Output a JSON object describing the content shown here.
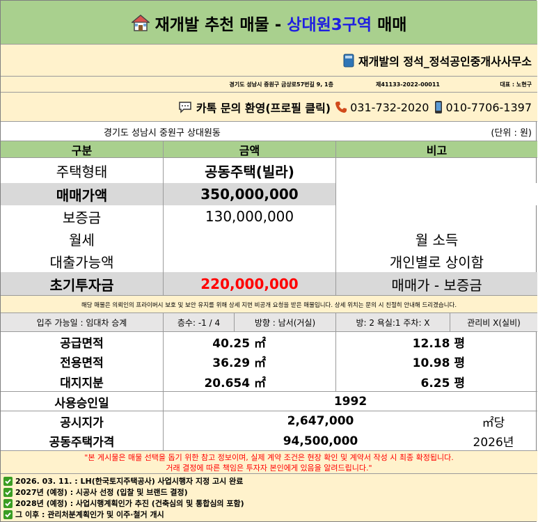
{
  "title": {
    "prefix": "재개발 추천 매물 - ",
    "highlight": "상대원3구역",
    "suffix": " 매매",
    "highlight_color": "#1f1fe0"
  },
  "office": {
    "name": "재개발의 정석_정석공인중개사사무소",
    "address": "경기도 성남시 중원구 금상로57번길 9, 1층",
    "reg_no": "제41133-2022-00011",
    "ceo": "대표 : 노현구",
    "contact_kakao": "카톡 문의 환영(프로필 클릭)",
    "phone1": "031-732-2020",
    "phone2": "010-7706-1397"
  },
  "location": "경기도 성남시 중원구 상대원동",
  "unit": "(단위 : 원)",
  "table": {
    "headers": [
      "구분",
      "금액",
      "비고"
    ],
    "rows": [
      {
        "label": "주택형태",
        "value": "공동주택(빌라)",
        "note": ""
      },
      {
        "label": "매매가액",
        "value": "350,000,000",
        "note": ""
      },
      {
        "label": "보증금",
        "value": "130,000,000",
        "note": ""
      },
      {
        "label": "월세",
        "value": "",
        "note": "월 소득"
      },
      {
        "label": "대출가능액",
        "value": "",
        "note": "개인별로 상이함"
      },
      {
        "label": "초기투자금",
        "value": "220,000,000",
        "note": "매매가 - 보증금"
      }
    ],
    "highlight_color": "#ff0000"
  },
  "privacy_note": "해당 매물은 의뢰인의 프라이버시 보호 및 보안 유지를 위해 상세 지번 비공개 요청을 받은 매물입니다. 상세 위치는 문의 시 친절히 안내해 드리겠습니다.",
  "details": {
    "move_in": "입주 가능일 : 임대차 승계",
    "floor": "층수: -1 / 4",
    "direction": "방향 : 남서(거실)",
    "rooms": "방: 2 욕실:1 주차: X",
    "mgmt": "관리비 X(실비)"
  },
  "area": [
    {
      "label": "공급면적",
      "m2": "40.25 ㎡",
      "pyeong": "12.18 평"
    },
    {
      "label": "전용면적",
      "m2": "36.29 ㎡",
      "pyeong": "10.98 평"
    },
    {
      "label": "대지지분",
      "m2": "20.654 ㎡",
      "pyeong": "6.25 평"
    }
  ],
  "approval": {
    "label": "사용승인일",
    "value": "1992"
  },
  "prices": [
    {
      "label": "공시지가",
      "value": "2,647,000",
      "note": "㎡당"
    },
    {
      "label": "공동주택가격",
      "value": "94,500,000",
      "note": "2026년"
    }
  ],
  "disclaimer": {
    "line1": "\"본 게시물은 매물 선택을 돕기 위한 참고 정보이며, 실제 계약 조건은 현장 확인 및 계약서 작성 시 최종 확정됩니다.",
    "line2": "거래 결정에 따른 책임은 투자자 본인에게 있음을 알려드립니다.\"",
    "color": "#ff0000"
  },
  "schedule": [
    {
      "date": "2026. 03. 11.",
      "text": " : LH(한국토지주택공사) 사업시행자 지정 고시 완료"
    },
    {
      "date": "2027년",
      "text": " (예정) : 시공사 선정 (입찰 및 브랜드 결정)"
    },
    {
      "date": "2028년",
      "text": " (예정) : 사업시행계획인가 추진 (건축심의 및 통합심의 포함)"
    },
    {
      "date": "그 이후",
      "text": " : 관리처분계획인가 및 이주·철거 개시"
    }
  ],
  "icons": {
    "title": "house-icon",
    "office": "book-icon",
    "kakao": "chat-icon",
    "phone1": "phone-icon",
    "phone2": "mobile-icon",
    "schedule": "check-icon"
  }
}
